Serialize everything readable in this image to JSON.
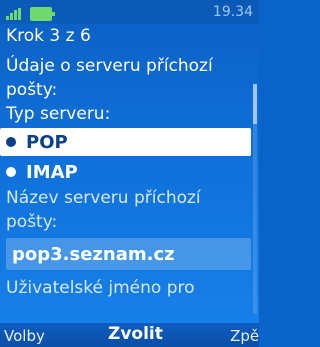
{
  "status": {
    "time": "19.34"
  },
  "wizard": {
    "step": "Krok 3 z 6",
    "incoming_label": "Údaje o serveru příchozí",
    "incoming_label_2": "pošty:",
    "server_type_label": "Typ serveru:",
    "server_types": [
      "POP",
      "IMAP"
    ],
    "selected_server_type": "POP",
    "server_name_label": "Název serveru příchozí",
    "server_name_label_2": "pošty:",
    "server_name_value": "pop3.seznam.cz",
    "username_label": "Uživatelské jméno pro"
  },
  "softkeys": {
    "left": "Volby",
    "center": "Zvolit",
    "right": "Zpět"
  },
  "colors": {
    "background": "#0e6fd8",
    "selected_row": "#ffffff",
    "signal": "#6fd86f"
  }
}
